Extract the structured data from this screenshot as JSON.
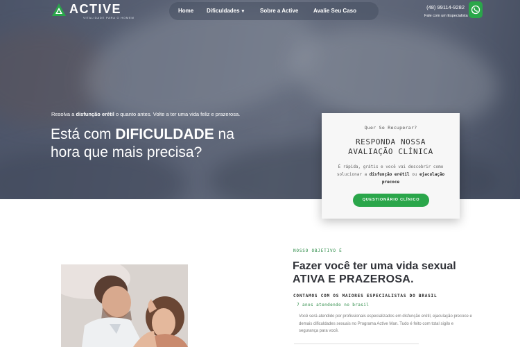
{
  "brand": {
    "name": "ACTIVE",
    "tagline": "VITALIDADE PARA O HOMEM",
    "color": "#2aa64a"
  },
  "nav": {
    "items": [
      {
        "label": "Home"
      },
      {
        "label": "Dificuldades",
        "has_dropdown": true
      },
      {
        "label": "Sobre a Active"
      },
      {
        "label": "Avalie Seu Caso"
      }
    ]
  },
  "contact": {
    "phone": "(48) 99114-9282",
    "cta": "Fale com um Especialista",
    "icon": "whatsapp-icon"
  },
  "hero": {
    "subtitle_prefix": "Resolva a ",
    "subtitle_bold": "disfunção erétil",
    "subtitle_suffix": " o quanto antes. Volte a ter uma vida feliz e prazerosa.",
    "title_line1_prefix": "Está com ",
    "title_line1_bold": "DIFICULDADE",
    "title_line1_suffix": " na",
    "title_line2": "hora que mais precisa?"
  },
  "card": {
    "kicker": "Quer Se Recuperar?",
    "title_line1": "RESPONDA NOSSA",
    "title_line2": "AVALIAÇÃO CLÍNICA",
    "text_prefix": "É rápida, grátis e você vai descobrir como solucionar a ",
    "text_bold1": "disfunção erétil",
    "text_mid": " ou ",
    "text_bold2": "ejaculação precoce",
    "button": "QUESTIONÁRIO CLÍNICO"
  },
  "objective": {
    "kicker": "NOSSO OBJETIVO É",
    "title_line1": "Fazer você ter uma vida sexual",
    "title_line2": "ATIVA E PRAZEROSA.",
    "specialists_title": "CONTAMOS COM OS MAIORES ESPECIALISTAS DO BRASIL",
    "specialists_sub": "7 anos atendendo no brasil",
    "body": "Você será atendido por profissionais especializados em disfunção erétil, ejaculação precoce e demais dificuldades sexuais no Programa Active Man. Tudo é feito com total sigilo e segurança para você."
  }
}
